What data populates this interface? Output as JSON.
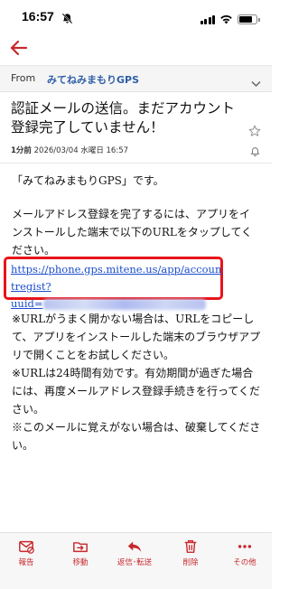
{
  "status_bar": {
    "time": "16:57"
  },
  "header": {
    "from_label": "From",
    "from_value": "みてねみまもりGPS"
  },
  "subject": "認証メールの送信。まだアカウント登録完了していません！",
  "meta": {
    "ago": "1分前",
    "datetime": "2026/03/04 水曜日 16:57"
  },
  "body": {
    "greeting": "「みてねみまもりGPS」です。",
    "instruction": "メールアドレス登録を完了するには、アプリをインストールした端末で以下のURLをタップしてください。",
    "link_line1": "https://phone.gps.mitene.us/app/accountregist?",
    "link_line2": "uuid=",
    "note1": "※URLがうまく開かない場合は、URLをコピーして、アプリをインストールした端末のブラウザアプリで開くことをお試しください。",
    "note2": "※URLは24時間有効です。有効期間が過ぎた場合には、再度メールアドレス登録手続きを行ってください。",
    "note3": "※このメールに覚えがない場合は、破棄してください。"
  },
  "toolbar": {
    "report": "報告",
    "move": "移動",
    "reply": "返信･転送",
    "delete": "削除",
    "more": "その他"
  },
  "colors": {
    "accent": "#c8282d",
    "link": "#1a4dcc",
    "highlight": "#e8141a"
  }
}
